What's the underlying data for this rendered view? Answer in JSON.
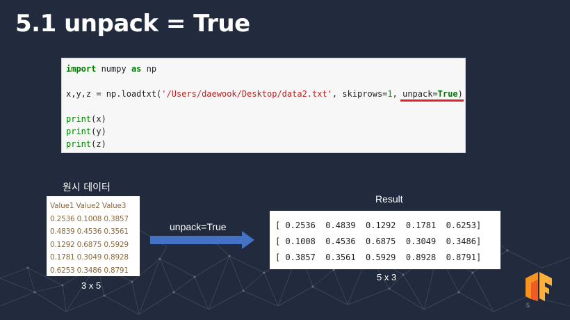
{
  "slide": {
    "title": "5.1 unpack = True",
    "page_number": "5"
  },
  "code": {
    "import_kw": "import",
    "import_module": " numpy ",
    "as_kw": "as",
    "alias": " np",
    "loadtxt_prefix": "x,y,z = np.loadtxt(",
    "path_string": "'/Users/daewook/Desktop/data2.txt'",
    "skiprows_text": ", skiprows=",
    "skiprows_value": "1",
    "unpack_text": ", unpack=",
    "unpack_value": "True",
    "close_paren": ")",
    "print_fn": "print",
    "print_args": [
      "(x)",
      "(y)",
      "(z)"
    ]
  },
  "raw_data": {
    "label": "원시 데이터",
    "rows": [
      "Value1  Value2  Value3",
      "0.2536  0.1008  0.3857",
      "0.4839  0.4536  0.3561",
      "0.1292  0.6875  0.5929",
      "0.1781  0.3049  0.8928",
      "0.6253  0.3486  0.8791"
    ],
    "dims": "3 x 5"
  },
  "transform": {
    "label": "unpack=True",
    "arrow_color": "#4472c4"
  },
  "result": {
    "label": "Result",
    "rows": [
      "[ 0.2536  0.4839  0.1292  0.1781  0.6253]",
      "[ 0.1008  0.4536  0.6875  0.3049  0.3486]",
      "[ 0.3857  0.3561  0.5929  0.8928  0.8791]"
    ],
    "dims": "5 x 3"
  },
  "logo": {
    "icon": "tensorflow-logo-icon",
    "color": "#f7931e"
  },
  "colors": {
    "background": "#222b3e",
    "underline": "#e0202a"
  }
}
